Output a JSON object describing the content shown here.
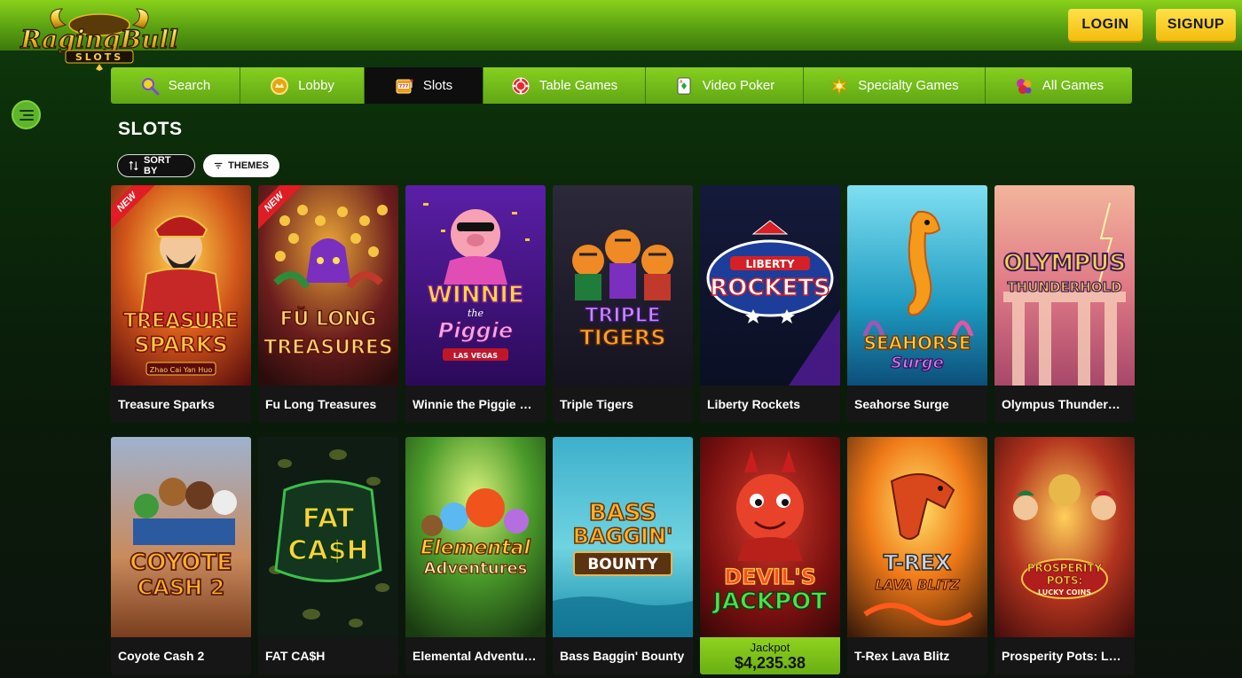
{
  "header": {
    "brand": "RagingBull",
    "brand_sub": "SLOTS",
    "login_label": "LOGIN",
    "signup_label": "SIGNUP"
  },
  "nav": {
    "items": [
      {
        "label": "Search",
        "icon": "search-icon"
      },
      {
        "label": "Lobby",
        "icon": "lobby-icon"
      },
      {
        "label": "Slots",
        "icon": "slot-machine-icon",
        "active": true
      },
      {
        "label": "Table Games",
        "icon": "poker-chip-icon"
      },
      {
        "label": "Video Poker",
        "icon": "playing-card-icon"
      },
      {
        "label": "Specialty Games",
        "icon": "star-burst-icon"
      },
      {
        "label": "All Games",
        "icon": "all-games-icon"
      }
    ]
  },
  "page": {
    "title": "SLOTS",
    "sort_label": "SORT BY",
    "themes_label": "THEMES"
  },
  "games_row1": [
    {
      "name": "Treasure Sparks",
      "art_line1": "TREASURE",
      "art_line2": "SPARKS",
      "art_line3": "Zhao Cai Yan Huo",
      "badge": "NEW"
    },
    {
      "name": "Fu Long Treasures",
      "art_line1": "FŬ LONG",
      "art_line2": "TREASURES",
      "badge": "NEW"
    },
    {
      "name": "Winnie the Piggie La...",
      "art_line1": "WINNIE",
      "art_line2": "the",
      "art_line3": "Piggie",
      "art_line4": "LAS VEGAS"
    },
    {
      "name": "Triple Tigers",
      "art_line1": "TRIPLE",
      "art_line2": "TIGERS"
    },
    {
      "name": "Liberty Rockets",
      "art_line1": "LIBERTY",
      "art_line2": "ROCKETS"
    },
    {
      "name": "Seahorse Surge",
      "art_line1": "SEAHORSE",
      "art_line2": "Surge"
    },
    {
      "name": "Olympus Thunderhold",
      "art_line1": "OLYMPUS",
      "art_line2": "THUNDERHOLD"
    }
  ],
  "games_row2": [
    {
      "name": "Coyote Cash 2",
      "art_line1": "COYOTE",
      "art_line2": "CASH 2"
    },
    {
      "name": "FAT CA$H",
      "art_line1": "FAT",
      "art_line2": "CA$H"
    },
    {
      "name": "Elemental Adventures",
      "art_line1": "Elemental",
      "art_line2": "Adventures"
    },
    {
      "name": "Bass Baggin' Bounty",
      "art_line1": "BASS",
      "art_line2": "BAGGIN'",
      "art_line3": "BOUNTY"
    },
    {
      "name": "Devil's Jackpot",
      "art_line1": "DEVIL'S",
      "art_line2": "JACKPOT",
      "jackpot_label": "Jackpot",
      "jackpot_amount": "$4,235.38"
    },
    {
      "name": "T-Rex Lava Blitz",
      "art_line1": "T-REX",
      "art_line2": "LAVA BLITZ"
    },
    {
      "name": "Prosperity Pots: Luc...",
      "art_line1": "PROSPERITY",
      "art_line2": "POTS:",
      "art_line3": "LUCKY COINS"
    }
  ],
  "colors": {
    "brand_green": "#7cc61c",
    "brand_yellow": "#f6c515",
    "active_nav": "#0e0e0e",
    "new_badge": "#e01d24"
  }
}
